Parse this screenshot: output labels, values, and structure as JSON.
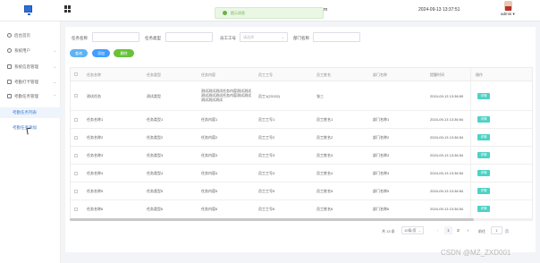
{
  "topbar": {
    "toast_text": "提示消息",
    "toast_tail": "m",
    "datetime": "2024-09-13 13:37:51",
    "user": "admin"
  },
  "sidebar": {
    "items": [
      {
        "label": "后台首页"
      },
      {
        "label": "系统用户"
      },
      {
        "label": "系统信息管理"
      },
      {
        "label": "考勤打卡管理"
      },
      {
        "label": "考勤任务管理"
      }
    ],
    "subitems": [
      {
        "label": "考勤任务列表"
      },
      {
        "label": "考勤任务添加"
      }
    ]
  },
  "filters": {
    "task_name_label": "任务名称",
    "task_type_label": "任务类型",
    "emp_no_label": "员工工号",
    "emp_no_placeholder": "请选择",
    "dept_label": "部门名称"
  },
  "buttons": {
    "search": "查询",
    "add": "添加",
    "delete": "删除"
  },
  "table": {
    "headers": [
      "任务名称",
      "任务类型",
      "任务内容",
      "员工工号",
      "员工姓名",
      "部门名称",
      "提醒时间",
      "操作"
    ],
    "op_label": "详情",
    "rows": [
      {
        "name": "测试任务",
        "type": "测试类型",
        "content": [
          "测试测试测试任务内容测试测试",
          "测试测试测试任务内容测试测试",
          "测试测试测试"
        ],
        "emp_no": "员工1(23132)",
        "emp_name": "张三",
        "dept": "",
        "time": "2024-09-13 13:38:59"
      },
      {
        "name": "任务名称1",
        "type": "任务类型1",
        "content": [
          "任务内容1"
        ],
        "emp_no": "员工工号1",
        "emp_name": "员工姓名1",
        "dept": "部门名称1",
        "time": "2024-09-13 13:36:54"
      },
      {
        "name": "任务名称2",
        "type": "任务类型2",
        "content": [
          "任务内容2"
        ],
        "emp_no": "员工工号2",
        "emp_name": "员工姓名2",
        "dept": "部门名称2",
        "time": "2024-09-13 13:36:54"
      },
      {
        "name": "任务名称3",
        "type": "任务类型3",
        "content": [
          "任务内容3"
        ],
        "emp_no": "员工工号3",
        "emp_name": "员工姓名3",
        "dept": "部门名称3",
        "time": "2024-09-13 13:36:54"
      },
      {
        "name": "任务名称4",
        "type": "任务类型4",
        "content": [
          "任务内容4"
        ],
        "emp_no": "员工工号4",
        "emp_name": "员工姓名4",
        "dept": "部门名称4",
        "time": "2024-09-13 13:36:54"
      },
      {
        "name": "任务名称5",
        "type": "任务类型5",
        "content": [
          "任务内容5"
        ],
        "emp_no": "员工工号5",
        "emp_name": "员工姓名5",
        "dept": "部门名称5",
        "time": "2024-09-13 13:36:54"
      },
      {
        "name": "任务名称6",
        "type": "任务类型6",
        "content": [
          "任务内容6"
        ],
        "emp_no": "员工工号6",
        "emp_name": "员工姓名6",
        "dept": "部门名称6",
        "time": "2024-09-13 13:36:54"
      }
    ]
  },
  "pager": {
    "total": "共 13 条",
    "per_page": "10条/页",
    "prev": "‹",
    "page1": "1",
    "page2": "2",
    "next": "›",
    "goto": "前往",
    "goto_value": "1",
    "page_suffix": "页"
  },
  "watermark": "CSDN @MZ_ZXD001",
  "colors": {
    "accent": "#3a7bd5",
    "search_btn": "#5fb3f3",
    "add_btn": "#409eff",
    "delete_btn": "#67c23a",
    "op_btn": "#4fd1c5",
    "toast_bg": "#eaf7e5"
  }
}
